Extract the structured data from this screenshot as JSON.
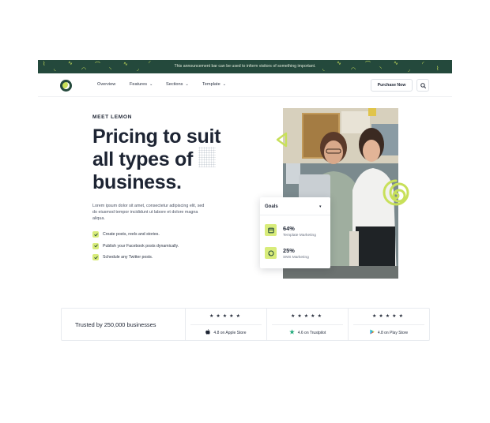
{
  "announcement": {
    "text": "This announcement bar can be used to inform visitors of something important."
  },
  "nav": {
    "items": [
      {
        "label": "Overview",
        "has_dropdown": false
      },
      {
        "label": "Features",
        "has_dropdown": true
      },
      {
        "label": "Sections",
        "has_dropdown": true
      },
      {
        "label": "Template",
        "has_dropdown": true
      }
    ],
    "purchase_label": "Purchase Now",
    "search_icon": "search-icon"
  },
  "hero": {
    "eyebrow": "MEET LEMON",
    "headline": "Pricing to suit all types of business.",
    "description": "Lorem ipsum dolor sit amet, consectetur adipiscing elit, sed do eiusmod tempor incididunt ut labore et dolore magna aliqua.",
    "features": [
      "Create posts, reels and stories.",
      "Publish your Facebook posts dynamically.",
      "Schedule any Twitter posts."
    ]
  },
  "goals": {
    "title": "Goals",
    "stats": [
      {
        "value": "64%",
        "label": "Template Marketing",
        "icon": "layout-icon"
      },
      {
        "value": "25%",
        "label": "SMS Marketing",
        "icon": "chat-icon"
      }
    ]
  },
  "trusted": {
    "label": "Trusted by 250,000 businesses",
    "ratings": [
      {
        "stars": "★★★★★",
        "text": "4.8 on Apple Store",
        "icon": "apple-icon"
      },
      {
        "stars": "★★★★★",
        "text": "4.6 on Trustpilot",
        "icon": "trustpilot-star-icon"
      },
      {
        "stars": "★★★★★",
        "text": "4.8 on Play Store",
        "icon": "play-store-icon"
      }
    ]
  },
  "colors": {
    "brand_dark": "#24493c",
    "accent_lime": "#c8e05a",
    "text_dark": "#1d2433"
  }
}
